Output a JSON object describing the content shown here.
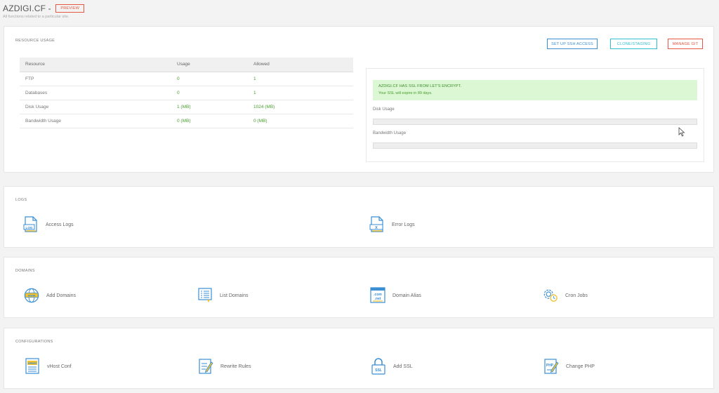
{
  "header": {
    "site_title": "AZDIGI.CF - ",
    "preview_badge": "PREVIEW",
    "subtitle": "All functions related to a particular site."
  },
  "resource_usage": {
    "title": "RESOURCE USAGE",
    "buttons": {
      "ssh": "SET UP SSH ACCESS",
      "clone": "CLONE/STAGING",
      "git": "MANAGE GIT"
    },
    "columns": [
      "Resource",
      "Usage",
      "Allowed"
    ],
    "rows": [
      {
        "resource": "FTP",
        "usage": "0",
        "allowed": "1"
      },
      {
        "resource": "Databases",
        "usage": "0",
        "allowed": "1"
      },
      {
        "resource": "Disk Usage",
        "usage": "1 (MB)",
        "allowed": "1024 (MB)"
      },
      {
        "resource": "Bandwidth Usage",
        "usage": "0 (MB)",
        "allowed": "0 (MB)"
      }
    ],
    "ssl_notice": "AZDIGI.CF HAS SSL FROM LET'S ENCRYPT.",
    "ssl_expiry": "Your SSL will expire in 89 days.",
    "disk_label": "Disk Usage",
    "disk_percent": 0,
    "bandwidth_label": "Bandwidth Usage",
    "bandwidth_percent": 0
  },
  "logs": {
    "title": "LOGS",
    "items": [
      {
        "label": "Access Logs",
        "icon": "access-log-icon"
      },
      {
        "label": "Error Logs",
        "icon": "error-log-icon"
      }
    ]
  },
  "domains": {
    "title": "DOMAINS",
    "items": [
      {
        "label": "Add Domains",
        "icon": "globe-www-icon"
      },
      {
        "label": "List Domains",
        "icon": "list-domains-icon"
      },
      {
        "label": "Domain Alias",
        "icon": "domain-alias-icon"
      },
      {
        "label": "Cron Jobs",
        "icon": "cron-gear-icon"
      }
    ]
  },
  "configurations": {
    "title": "CONFIGURATIONS",
    "items": [
      {
        "label": "vHost Conf",
        "icon": "vhost-icon"
      },
      {
        "label": "Rewrite Rules",
        "icon": "rewrite-rules-icon"
      },
      {
        "label": "Add SSL",
        "icon": "ssl-lock-icon"
      },
      {
        "label": "Change PHP",
        "icon": "php-icon"
      }
    ]
  },
  "colors": {
    "accent_blue": "#3a8ed4",
    "accent_cyan": "#2ebfd1",
    "accent_red": "#e8573f",
    "success_green": "#4a9e2f",
    "alert_bg": "#dbf7d4",
    "icon_yellow": "#f2c230"
  }
}
